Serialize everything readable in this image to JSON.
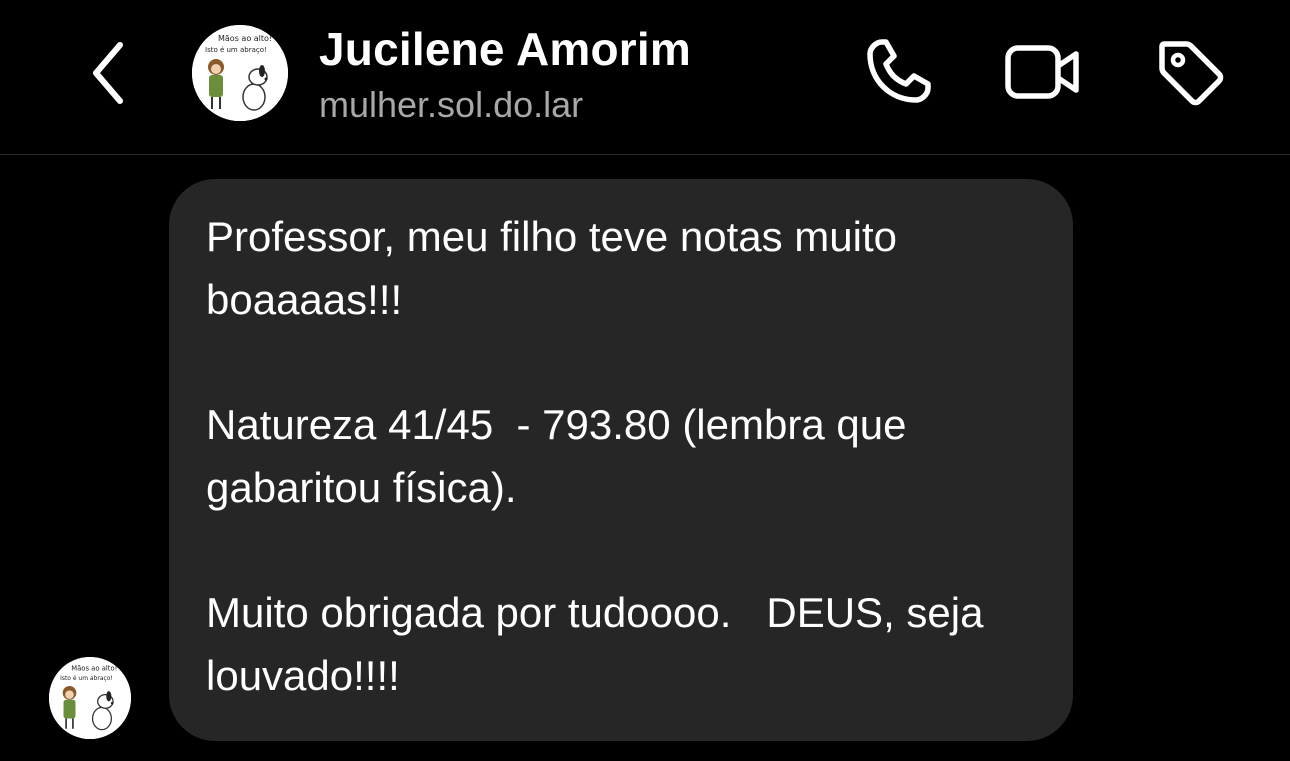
{
  "header": {
    "name": "Jucilene Amorim",
    "username": "mulher.sol.do.lar",
    "icons": {
      "back": "chevron-left-icon",
      "call": "phone-icon",
      "video": "video-camera-icon",
      "tag": "tag-icon"
    }
  },
  "avatar": {
    "caption_line1": "Mãos ao alto!",
    "caption_line2": "Isto é um abraço!"
  },
  "message": {
    "paragraphs": [
      "Professor, meu filho teve notas muito boaaaas!!!",
      "Natureza 41/45  - 793.80 (lembra que gabaritou física).",
      "Muito obrigada por tudoooo.   DEUS, seja louvado!!!!"
    ]
  },
  "colors": {
    "background": "#000000",
    "bubble": "#262626",
    "text": "#ffffff",
    "secondary_text": "#a8a8a8"
  }
}
